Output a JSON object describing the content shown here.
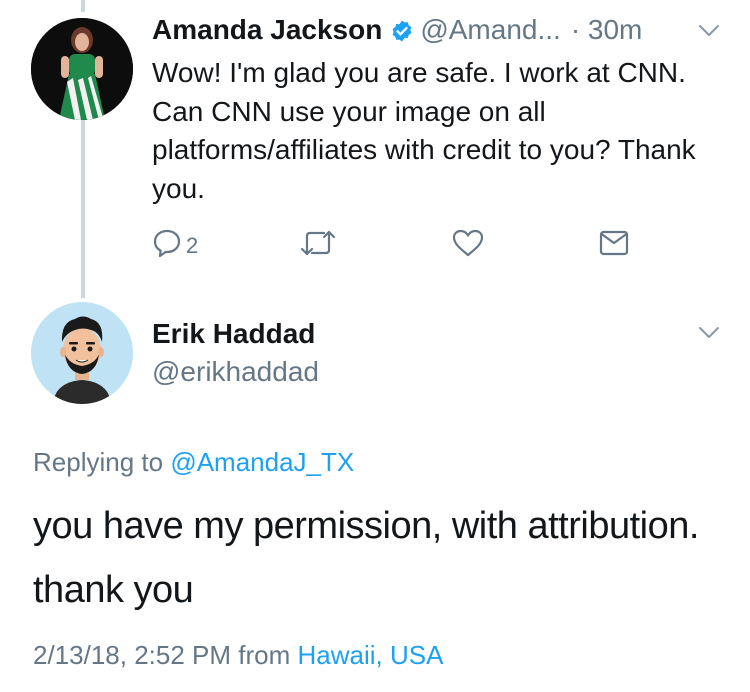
{
  "tweet1": {
    "name": "Amanda Jackson",
    "handle": "@Amand...",
    "time": "· 30m",
    "text": "Wow! I'm glad you are safe. I work at CNN. Can CNN use your image on all platforms/affiliates with credit to you? Thank you.",
    "reply_count": "2",
    "icons": [
      "verified-badge-icon",
      "chevron-down-icon",
      "reply-icon",
      "retweet-icon",
      "like-icon",
      "message-icon"
    ]
  },
  "tweet2": {
    "name": "Erik Haddad",
    "handle": "@erikhaddad",
    "replying_prefix": "Replying to",
    "replying_to": "@AmandaJ_TX",
    "text": "you have my permission, with attribution. thank you",
    "timestamp": "2/13/18, 2:52 PM from",
    "location": "Hawaii, USA"
  },
  "colors": {
    "text": "#14171a",
    "secondary": "#657786",
    "link": "#1da1f2",
    "thread_line": "#ccd6dd",
    "avatar_bg": "#bfe3f5"
  }
}
